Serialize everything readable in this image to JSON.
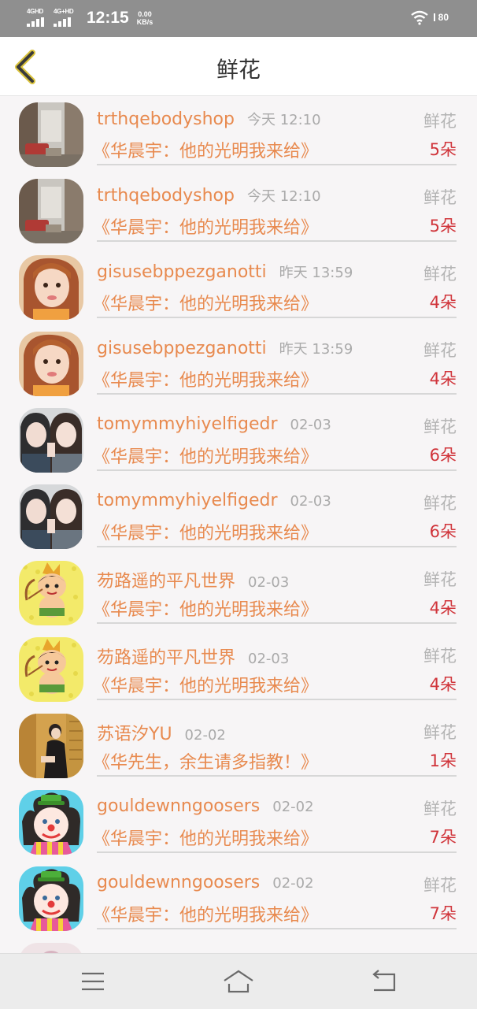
{
  "status_bar": {
    "signal1": "4GHD",
    "signal2": "4G+HD",
    "time": "12:15",
    "speed_value": "0.00",
    "speed_unit": "KB/s",
    "battery": "80"
  },
  "header": {
    "title": "鲜花"
  },
  "rows": [
    {
      "username": "trthqebodyshop",
      "time": "今天 12:10",
      "gift": "鲜花",
      "work": "《华晨宇：他的光明我来给》",
      "count": "5朵",
      "avatar": "street"
    },
    {
      "username": "trthqebodyshop",
      "time": "今天 12:10",
      "gift": "鲜花",
      "work": "《华晨宇：他的光明我来给》",
      "count": "5朵",
      "avatar": "street"
    },
    {
      "username": "gisusebppezganotti",
      "time": "昨天 13:59",
      "gift": "鲜花",
      "work": "《华晨宇：他的光明我来给》",
      "count": "4朵",
      "avatar": "girl"
    },
    {
      "username": "gisusebppezganotti",
      "time": "昨天 13:59",
      "gift": "鲜花",
      "work": "《华晨宇：他的光明我来给》",
      "count": "4朵",
      "avatar": "girl"
    },
    {
      "username": "tomymmyhiyelfigedr",
      "time": "02-03",
      "gift": "鲜花",
      "work": "《华晨宇：他的光明我来给》",
      "count": "6朵",
      "avatar": "pair"
    },
    {
      "username": "tomymmyhiyelfigedr",
      "time": "02-03",
      "gift": "鲜花",
      "work": "《华晨宇：他的光明我来给》",
      "count": "6朵",
      "avatar": "pair"
    },
    {
      "username": "芴路遥的平凡世界",
      "time": "02-03",
      "gift": "鲜花",
      "work": "《华晨宇：他的光明我来给》",
      "count": "4朵",
      "avatar": "cartoon"
    },
    {
      "username": "芴路遥的平凡世界",
      "time": "02-03",
      "gift": "鲜花",
      "work": "《华晨宇：他的光明我来给》",
      "count": "4朵",
      "avatar": "cartoon"
    },
    {
      "username": "苏语汐YU",
      "time": "02-02",
      "gift": "鲜花",
      "work": "《华先生，余生请多指教！》",
      "count": "1朵",
      "avatar": "room"
    },
    {
      "username": "gouldewnngoosers",
      "time": "02-02",
      "gift": "鲜花",
      "work": "《华晨宇：他的光明我来给》",
      "count": "7朵",
      "avatar": "clown"
    },
    {
      "username": "gouldewnngoosers",
      "time": "02-02",
      "gift": "鲜花",
      "work": "《华晨宇：他的光明我来给》",
      "count": "7朵",
      "avatar": "clown"
    }
  ],
  "nav": {
    "menu": "menu-icon",
    "home": "home-icon",
    "back": "back-icon"
  }
}
